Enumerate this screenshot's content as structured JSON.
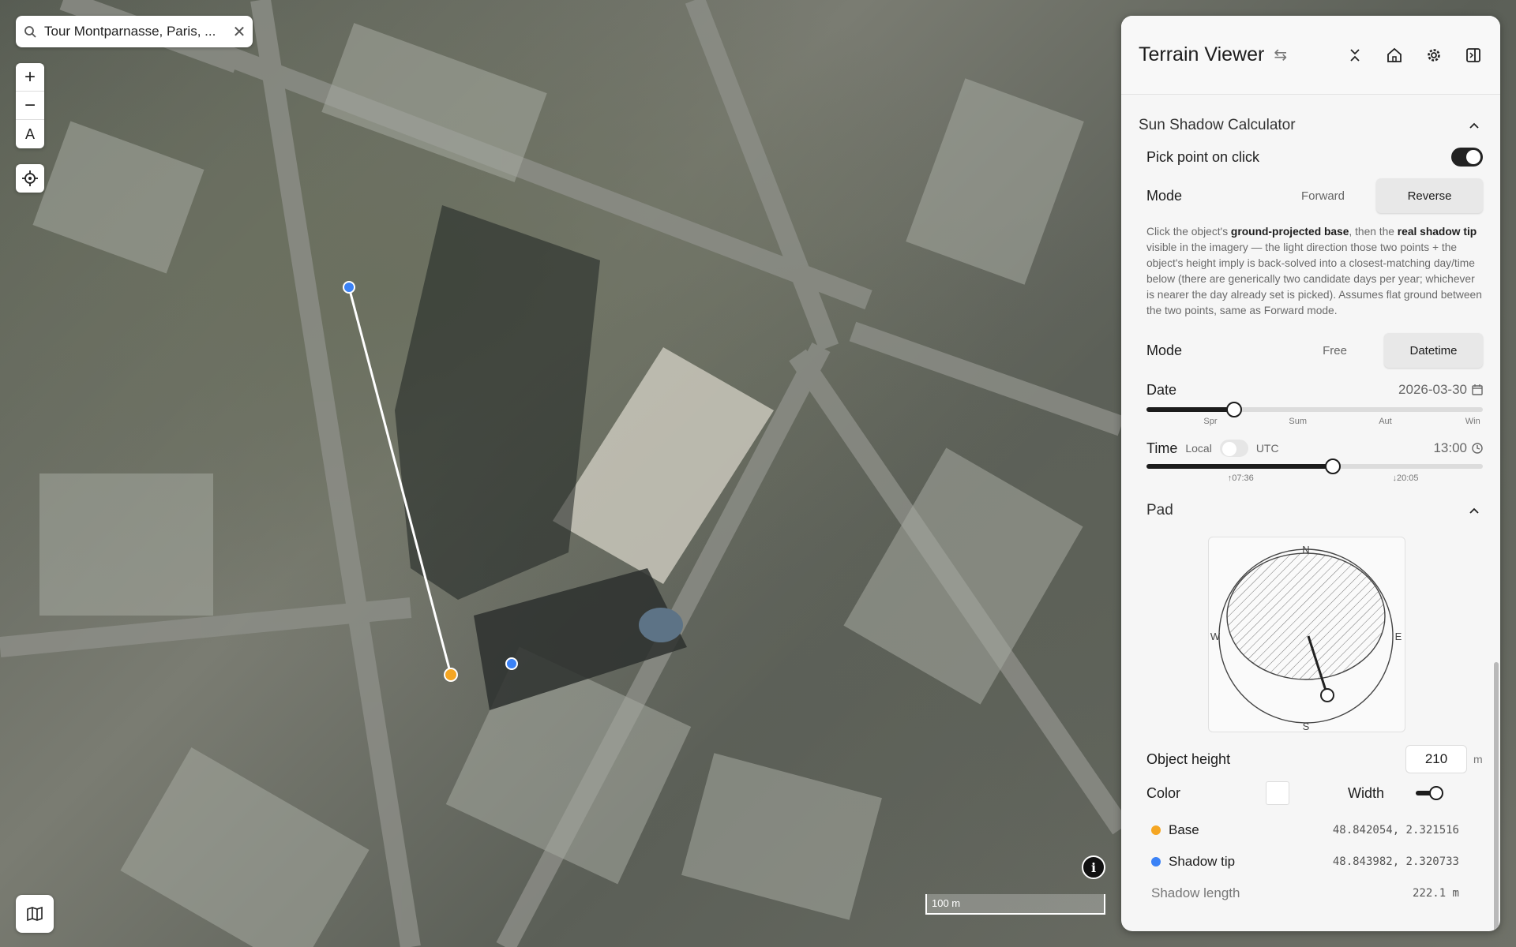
{
  "search": {
    "value": "Tour Montparnasse, Paris, ...",
    "clear_label": "✕"
  },
  "map_controls": {
    "zoom_in": "+",
    "zoom_out": "−",
    "compass": "A",
    "info": "i"
  },
  "scale_bar": {
    "label": "100 m"
  },
  "panel": {
    "title": "Terrain Viewer",
    "section_title": "Sun Shadow Calculator",
    "pick_point_label": "Pick point on click",
    "mode_label": "Mode",
    "mode_options": [
      "Forward",
      "Reverse"
    ],
    "mode_selected": "Reverse",
    "description_parts": {
      "p1": "Click the object's ",
      "b1": "ground-projected base",
      "p2": ", then the ",
      "b2": "real shadow tip",
      "p3": " visible in the imagery — the light direction those two points + the object's height imply is back-solved into a closest-matching day/time below (there are generically two candidate days per year; whichever is nearer the day already set is picked). Assumes flat ground between the two points, same as Forward mode."
    },
    "mode2_label": "Mode",
    "mode2_options": [
      "Free",
      "Datetime"
    ],
    "mode2_selected": "Datetime",
    "date_label": "Date",
    "date_value": "2026-03-30",
    "date_ticks": [
      "Spr",
      "Sum",
      "Aut",
      "Win"
    ],
    "date_fraction": 0.26,
    "time_label": "Time",
    "time_local": "Local",
    "time_utc": "UTC",
    "time_value": "13:00",
    "time_ticks": [
      "↑07:36",
      "↓20:05"
    ],
    "time_fraction": 0.555,
    "pad_title": "Pad",
    "compass": {
      "n": "N",
      "s": "S",
      "e": "E",
      "w": "W"
    },
    "height_label": "Object height",
    "height_value": "210",
    "height_unit": "m",
    "color_label": "Color",
    "width_label": "Width",
    "base_label": "Base",
    "base_coord": "48.842054, 2.321516",
    "tip_label": "Shadow tip",
    "tip_coord": "48.843982, 2.320733",
    "length_label": "Shadow length",
    "length_value": "222.1 m"
  },
  "colors": {
    "base_dot": "#f5a623",
    "tip_dot": "#3b82f6",
    "accent": "#1c1c1c"
  }
}
